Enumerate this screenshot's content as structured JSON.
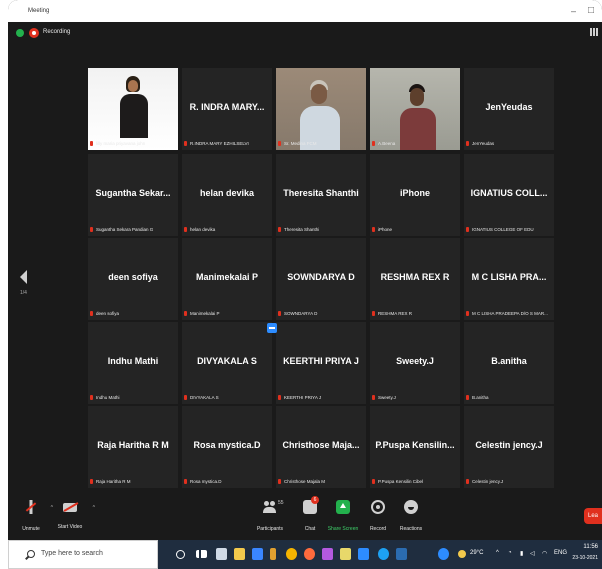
{
  "window": {
    "title": "Meeting"
  },
  "status": {
    "recording_label": "Recording"
  },
  "pager": {
    "page": "1/4"
  },
  "tiles": [
    {
      "name": "",
      "caption": "lilly maria priyavana john",
      "video": "v1"
    },
    {
      "name": "R. INDRA MARY...",
      "caption": "R.INDRA MARY EZHILSELVI"
    },
    {
      "name": "",
      "caption": "Sr. Medina FCM",
      "video": "v3"
    },
    {
      "name": "",
      "caption": "A.Beena",
      "video": "v4"
    },
    {
      "name": "JenYeudas",
      "caption": "JenYeudas"
    },
    {
      "name": "Sugantha Sekar...",
      "caption": "Sugantha Sekara Pandian G"
    },
    {
      "name": "helan devika",
      "caption": "helan devika"
    },
    {
      "name": "Theresita Shanthi",
      "caption": "Theresita Shanthi"
    },
    {
      "name": "iPhone",
      "caption": "iPhone"
    },
    {
      "name": "IGNATIUS COLL...",
      "caption": "IGNATIUS COLLEGE OF EDU"
    },
    {
      "name": "deen sofiya",
      "caption": "deen sofiya"
    },
    {
      "name": "Manimekalai P",
      "caption": "Manimekalai P"
    },
    {
      "name": "SOWNDARYA D",
      "caption": "SOWNDARYA D"
    },
    {
      "name": "RESHMA REX R",
      "caption": "RESHMA REX R"
    },
    {
      "name": "M C LISHA PRA...",
      "caption": "M C LISHA PRADEEPA D/O S MAR..."
    },
    {
      "name": "Indhu Mathi",
      "caption": "Indhu Mathi"
    },
    {
      "name": "DIVYAKALA S",
      "caption": "DIVYAKALA S"
    },
    {
      "name": "KEERTHI PRIYA J",
      "caption": "KEERTHI PRIYA J"
    },
    {
      "name": "Sweety.J",
      "caption": "Sweety.J"
    },
    {
      "name": "B.anitha",
      "caption": "B.anitha"
    },
    {
      "name": "Raja Haritha R M",
      "caption": "Raja Haritha R M"
    },
    {
      "name": "Rosa mystica.D",
      "caption": "Rosa mystica.D"
    },
    {
      "name": "Christhose Maja...",
      "caption": "Christhose Majala M"
    },
    {
      "name": "P.Puspa Kensilin...",
      "caption": "P.Puspa Kensilin Cibel"
    },
    {
      "name": "Celestin jency.J",
      "caption": "Celestin jency.J"
    }
  ],
  "toolbar": {
    "unmute": "Unmute",
    "start_video": "Start Video",
    "participants": "Participants",
    "participant_count": "55",
    "chat": "Chat",
    "chat_badge": "6",
    "share_screen": "Share Screen",
    "record": "Record",
    "reactions": "Reactions",
    "leave": "Lea"
  },
  "taskbar": {
    "search_placeholder": "Type here to search",
    "weather": "29°C",
    "language": "ENG",
    "time": "11:56",
    "date": "23-10-2021"
  },
  "colors": {
    "accent_green": "#23b14d",
    "recording_red": "#e0301e",
    "active_speaker": "#c7e84a",
    "zoom_blue": "#2d8cff"
  }
}
